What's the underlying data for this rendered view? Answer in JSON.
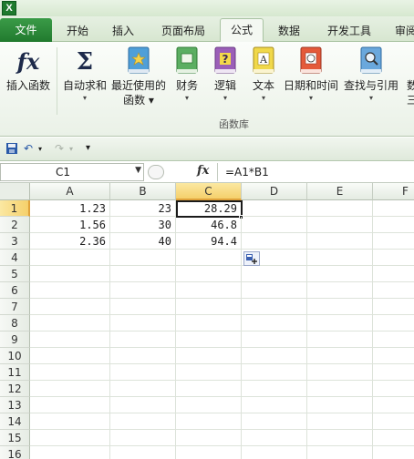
{
  "app": {
    "logo": "X"
  },
  "tabs": [
    {
      "label": "文件"
    },
    {
      "label": "开始"
    },
    {
      "label": "插入"
    },
    {
      "label": "页面布局"
    },
    {
      "label": "公式"
    },
    {
      "label": "数据"
    },
    {
      "label": "开发工具"
    },
    {
      "label": "审阅"
    }
  ],
  "ribbon": {
    "insert_function": "插入函数",
    "autosum": "自动求和",
    "recent_line1": "最近使用的",
    "recent_line2": "函数",
    "financial": "财务",
    "logical": "逻辑",
    "text": "文本",
    "datetime": "日期和时间",
    "lookup": "查找与引用",
    "math_partial": "数",
    "more_partial": "三",
    "group_label": "函数库",
    "fx_symbol": "fx",
    "sigma_symbol": "Σ"
  },
  "formula_bar": {
    "name_box": "C1",
    "fx": "fx",
    "formula": "=A1*B1"
  },
  "grid": {
    "columns": [
      "A",
      "B",
      "C",
      "D",
      "E",
      "F"
    ],
    "rows": [
      "1",
      "2",
      "3",
      "4",
      "5",
      "6",
      "7",
      "8",
      "9",
      "10",
      "11",
      "12",
      "13",
      "14",
      "15",
      "16"
    ],
    "data": [
      [
        "1.23",
        "23",
        "28.29"
      ],
      [
        "1.56",
        "30",
        "46.8"
      ],
      [
        "2.36",
        "40",
        "94.4"
      ]
    ],
    "selected_cell": "C1"
  },
  "colors": {
    "file_tab": "#2c8a3a",
    "selection_header": "#f5d06b",
    "accent_border": "#e0a23a"
  }
}
